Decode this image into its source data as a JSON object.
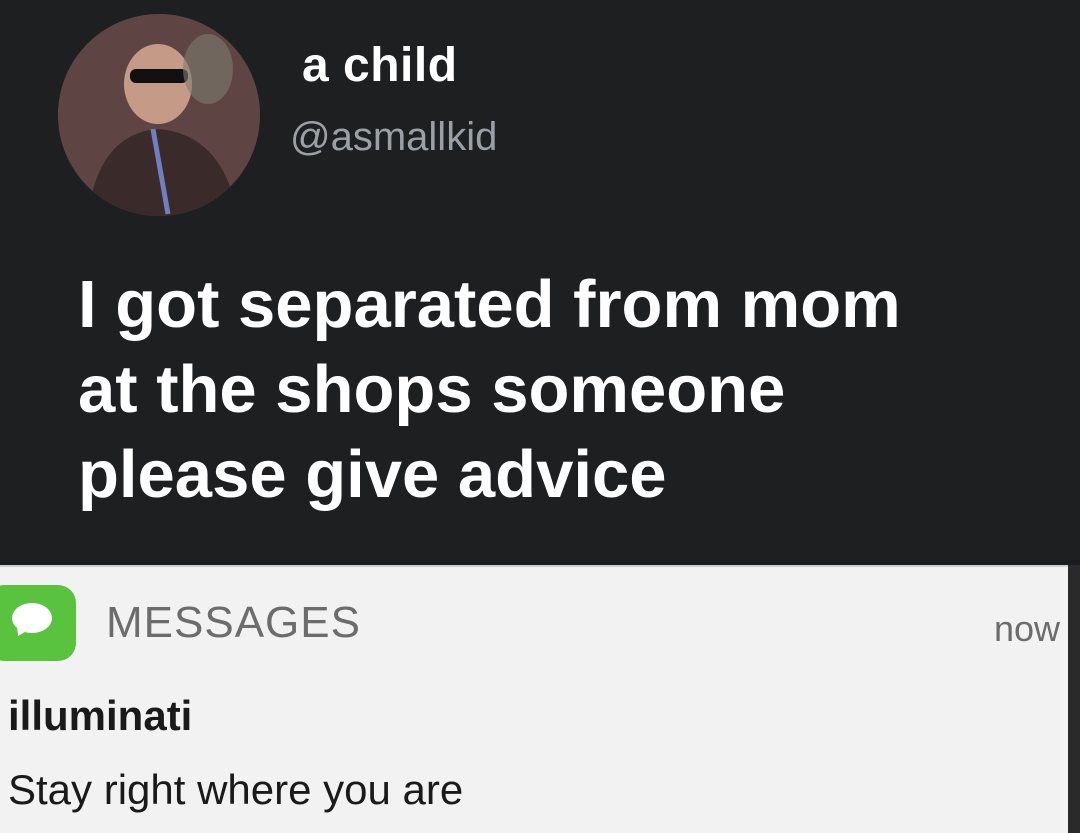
{
  "tweet": {
    "display_name": "a child",
    "handle": "@asmallkid",
    "text_lines": [
      "I got separated from mom",
      "at the shops someone",
      "please give advice"
    ]
  },
  "notification": {
    "app_name": "MESSAGES",
    "time": "now",
    "sender": "illuminati",
    "message": "Stay right where you are",
    "icon": "messages-app-icon",
    "accent_color": "#59c33f"
  },
  "colors": {
    "tweet_background": "#1e1f21",
    "notification_background": "#f2f2f2",
    "name_color": "#ffffff",
    "handle_color": "#9aa0a6"
  }
}
